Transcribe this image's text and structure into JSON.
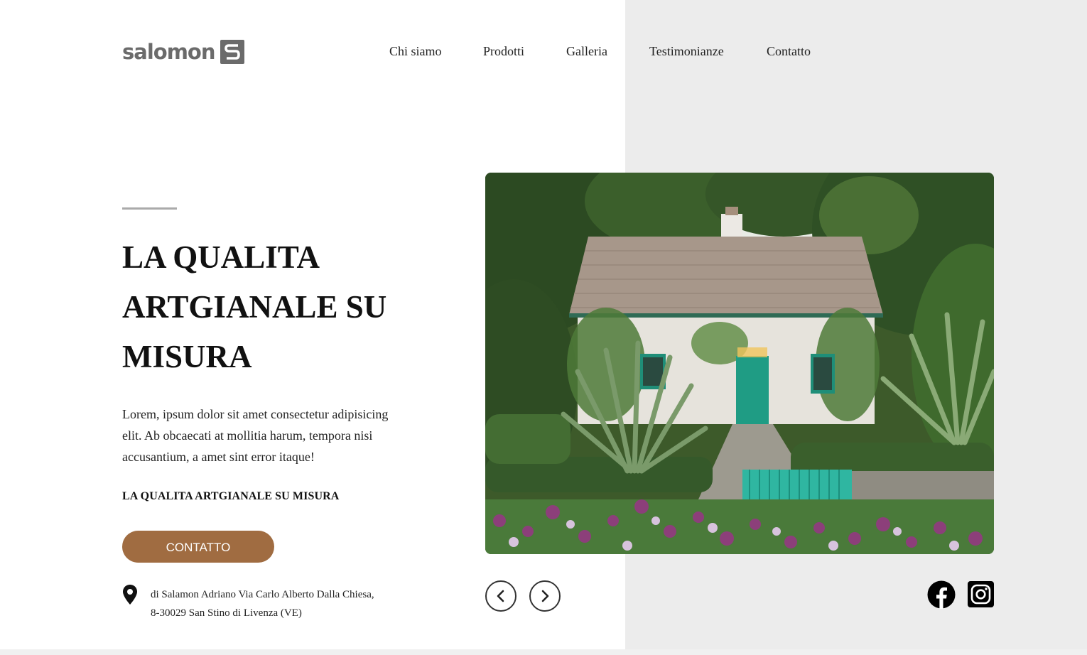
{
  "header": {
    "logo_text": "salomon",
    "nav": [
      "Chi siamo",
      "Prodotti",
      "Galleria",
      "Testimonianze",
      "Contatto"
    ]
  },
  "hero": {
    "title": "LA QUALITA ARTGIANALE SU MISURA",
    "body": "Lorem, ipsum dolor sit amet consectetur adipisicing elit. Ab obcaecati at mollitia harum, tempora nisi accusantium, a amet sint error itaque!",
    "subtitle": "LA QUALITA ARTGIANALE SU MISURA",
    "cta_label": "CONTATTO",
    "address_line1": "di Salamon Adriano Via Carlo Alberto Dalla Chiesa,",
    "address_line2": "8-30029 San Stino di Livenza (VE)"
  },
  "icons": {
    "location": "map-pin-icon",
    "prev": "chevron-left-icon",
    "next": "chevron-right-icon",
    "facebook": "facebook-icon",
    "instagram": "instagram-icon"
  },
  "colors": {
    "accent": "#a06c41",
    "panel": "#ececec",
    "logo": "#6b6b6b"
  }
}
